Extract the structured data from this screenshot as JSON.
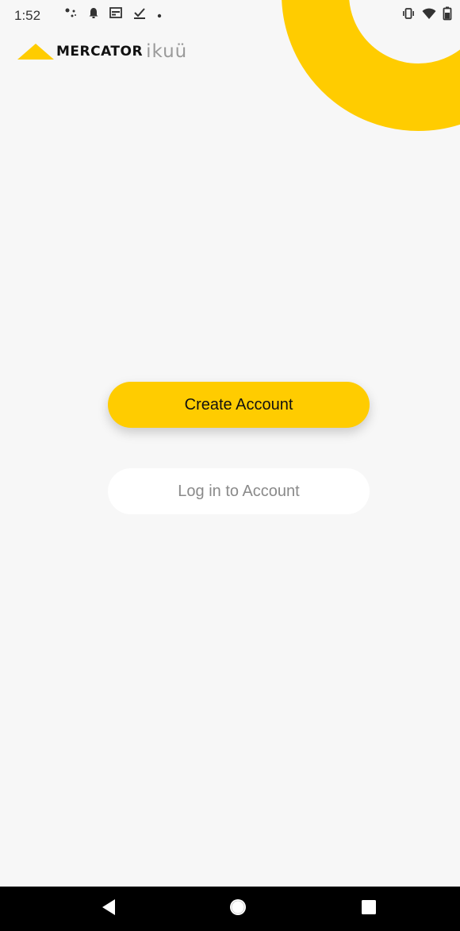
{
  "status_bar": {
    "time": "1:52",
    "left_icons": [
      "assistant-dots-icon",
      "notification-bell-icon",
      "media-card-icon",
      "download-check-icon",
      "dot-icon"
    ],
    "right_icons": [
      "vibrate-icon",
      "wifi-icon",
      "battery-icon"
    ]
  },
  "logo": {
    "brand": "MERCATOR",
    "sub": "ikuü"
  },
  "buttons": {
    "create_account": "Create Account",
    "log_in": "Log in to Account"
  },
  "nav": {
    "back": "back-icon",
    "home": "home-icon",
    "recents": "recents-icon"
  },
  "colors": {
    "accent": "#ffcc00",
    "background": "#f7f7f7",
    "nav_bar": "#000000"
  }
}
